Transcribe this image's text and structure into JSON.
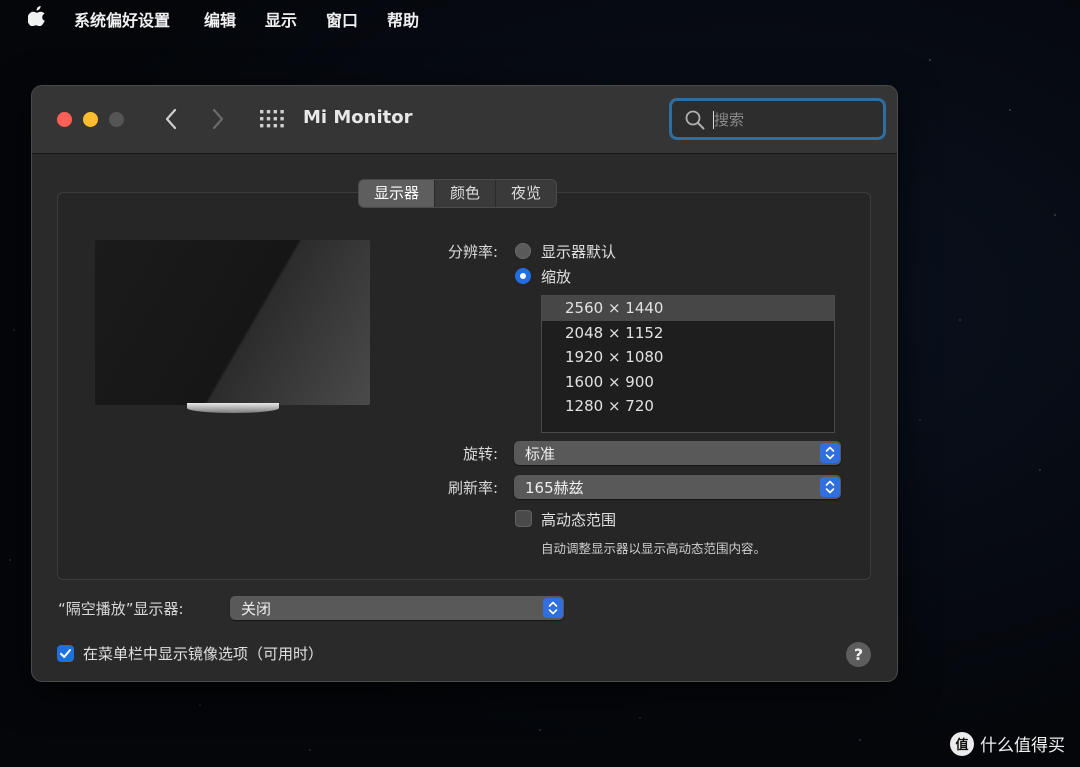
{
  "menubar": {
    "icon": "apple-icon",
    "items": [
      "系统偏好设置",
      "编辑",
      "显示",
      "窗口",
      "帮助"
    ]
  },
  "window": {
    "title": "Mi Monitor",
    "search": {
      "value": "",
      "placeholder": "搜索"
    },
    "tabs": [
      {
        "label": "显示器",
        "active": true
      },
      {
        "label": "颜色",
        "active": false
      },
      {
        "label": "夜览",
        "active": false
      }
    ]
  },
  "display": {
    "resolution_label": "分辨率:",
    "options": [
      {
        "label": "显示器默认",
        "selected": false
      },
      {
        "label": "缩放",
        "selected": true
      }
    ],
    "resolutions": [
      "2560 × 1440",
      "2048 × 1152",
      "1920 × 1080",
      "1600 × 900",
      "1280 × 720"
    ],
    "selected_resolution": "2560 × 1440",
    "rotation_label": "旋转:",
    "rotation_value": "标准",
    "refresh_label": "刷新率:",
    "refresh_value": "165赫兹",
    "hdr_label": "高动态范围",
    "hdr_checked": false,
    "hdr_note": "自动调整显示器以显示高动态范围内容。"
  },
  "airplay": {
    "label": "“隔空播放”显示器:",
    "value": "关闭"
  },
  "mirror_option": {
    "label": "在菜单栏中显示镜像选项（可用时）",
    "checked": true
  },
  "help_label": "?",
  "watermark": {
    "text": "什么值得买",
    "logo_glyph": "值"
  },
  "colors": {
    "accent": "#1f6fe0",
    "close": "#fe5f57",
    "minimize": "#febc2e",
    "zoom_disabled": "#555555"
  }
}
